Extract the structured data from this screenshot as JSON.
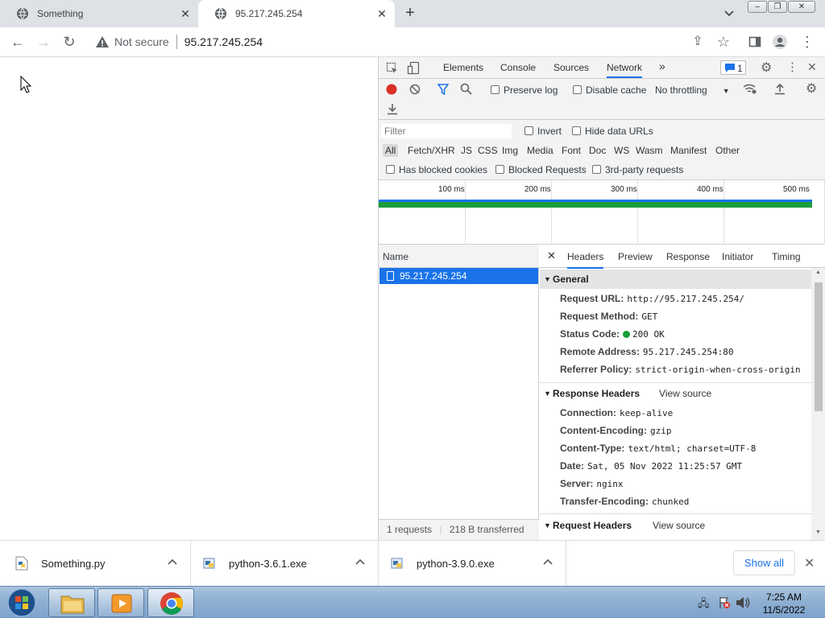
{
  "browser": {
    "tabs": [
      {
        "title": "Something"
      },
      {
        "title": "95.217.245.254"
      }
    ],
    "security_label": "Not secure",
    "url": "95.217.245.254"
  },
  "devtools": {
    "tabs": [
      "Elements",
      "Console",
      "Sources",
      "Network"
    ],
    "issues_count": "1",
    "toolbar": {
      "preserve_log": "Preserve log",
      "disable_cache": "Disable cache",
      "throttling": "No throttling"
    },
    "filter": {
      "placeholder": "Filter",
      "invert": "Invert",
      "hide_data_urls": "Hide data URLs",
      "types": [
        "All",
        "Fetch/XHR",
        "JS",
        "CSS",
        "Img",
        "Media",
        "Font",
        "Doc",
        "WS",
        "Wasm",
        "Manifest",
        "Other"
      ],
      "blocked_cookies": "Has blocked cookies",
      "blocked_requests": "Blocked Requests",
      "third_party": "3rd-party requests"
    },
    "timeline_ticks": [
      "100 ms",
      "200 ms",
      "300 ms",
      "400 ms",
      "500 ms"
    ],
    "request_list": {
      "header": "Name",
      "rows": [
        "95.217.245.254"
      ],
      "summary": "1 requests",
      "transferred": "218 B transferred"
    },
    "detail_tabs": [
      "Headers",
      "Preview",
      "Response",
      "Initiator",
      "Timing"
    ],
    "general": {
      "title": "General",
      "rows": [
        {
          "k": "Request URL:",
          "v": "http://95.217.245.254/"
        },
        {
          "k": "Request Method:",
          "v": "GET"
        },
        {
          "k": "Status Code:",
          "v": "200 OK"
        },
        {
          "k": "Remote Address:",
          "v": "95.217.245.254:80"
        },
        {
          "k": "Referrer Policy:",
          "v": "strict-origin-when-cross-origin"
        }
      ]
    },
    "response_headers": {
      "title": "Response Headers",
      "view_source": "View source",
      "rows": [
        {
          "k": "Connection:",
          "v": "keep-alive"
        },
        {
          "k": "Content-Encoding:",
          "v": "gzip"
        },
        {
          "k": "Content-Type:",
          "v": "text/html; charset=UTF-8"
        },
        {
          "k": "Date:",
          "v": "Sat, 05 Nov 2022 11:25:57 GMT"
        },
        {
          "k": "Server:",
          "v": "nginx"
        },
        {
          "k": "Transfer-Encoding:",
          "v": "chunked"
        }
      ]
    },
    "request_headers": {
      "title": "Request Headers",
      "view_source": "View source"
    }
  },
  "downloads": {
    "items": [
      "Something.py",
      "python-3.6.1.exe",
      "python-3.9.0.exe"
    ],
    "show_all": "Show all"
  },
  "taskbar": {
    "time": "7:25 AM",
    "date": "11/5/2022"
  },
  "colors": {
    "accent": "#1a73e8",
    "status_ok": "#1a9e3a",
    "record": "#d93025"
  }
}
